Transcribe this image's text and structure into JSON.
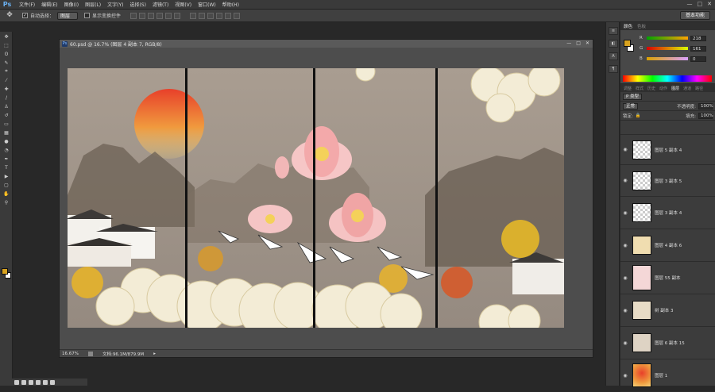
{
  "app": {
    "logo": "Ps"
  },
  "menu": [
    "文件(F)",
    "编辑(E)",
    "图像(I)",
    "图层(L)",
    "文字(Y)",
    "选择(S)",
    "滤镜(T)",
    "视图(V)",
    "窗口(W)",
    "帮助(H)"
  ],
  "options": {
    "auto_select_label": "自动选择：",
    "auto_select_value": "图层",
    "show_transform_label": "显示变换控件",
    "workspace": "基本功能"
  },
  "document": {
    "title": "60.psd @ 16.7% (图层 4 副本 7, RGB/8)",
    "zoom": "16.67%",
    "doc_info": "文档:96.1M/879.9M"
  },
  "color_panel": {
    "tabs": [
      "颜色",
      "色板"
    ],
    "r": "218",
    "g": "161",
    "b": "0",
    "fg": "#d9a31f",
    "bg": "#ffffff"
  },
  "layers_panel": {
    "tabs": [
      "调整",
      "样式",
      "历史",
      "动作",
      "图层",
      "通道",
      "路径"
    ],
    "kind": "P 类型",
    "blend": "正常",
    "opacity_label": "不透明度:",
    "opacity": "100%",
    "lock_label": "锁定:",
    "fill_label": "填充:",
    "fill": "100%",
    "layers": [
      {
        "name": "图层 5 副本 4"
      },
      {
        "name": "图层 3 副本 5"
      },
      {
        "name": "图层 3 副本 4"
      },
      {
        "name": "图层 4 副本 6"
      },
      {
        "name": "图层 55 副本"
      },
      {
        "name": "树 副本 3"
      },
      {
        "name": "图层 6 副本 15"
      },
      {
        "name": "图层 1"
      }
    ]
  }
}
